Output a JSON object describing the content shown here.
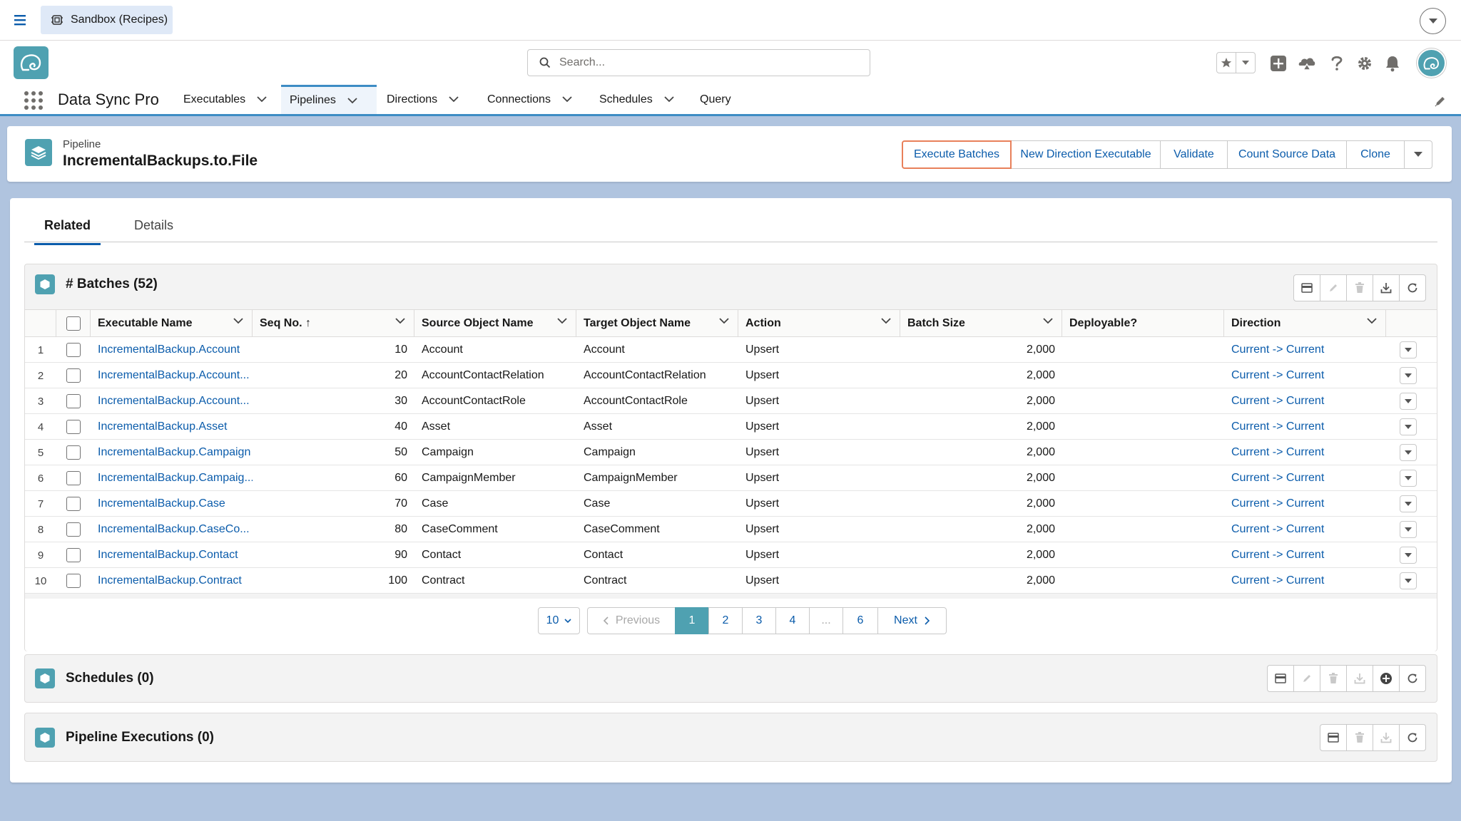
{
  "sandbox": {
    "label": "Sandbox (Recipes)"
  },
  "header": {
    "search_placeholder": "Search..."
  },
  "nav": {
    "app_name": "Data Sync Pro",
    "items": [
      {
        "label": "Executables"
      },
      {
        "label": "Pipelines"
      },
      {
        "label": "Directions"
      },
      {
        "label": "Connections"
      },
      {
        "label": "Schedules"
      },
      {
        "label": "Query"
      }
    ]
  },
  "record": {
    "type_label": "Pipeline",
    "title": "IncrementalBackups.to.File",
    "actions": [
      "Execute Batches",
      "New Direction Executable",
      "Validate",
      "Count Source Data",
      "Clone"
    ]
  },
  "tabs": [
    {
      "label": "Related"
    },
    {
      "label": "Details"
    }
  ],
  "batches": {
    "title": "# Batches (52)",
    "columns": [
      "Executable Name",
      "Seq No. ↑",
      "Source Object Name",
      "Target Object Name",
      "Action",
      "Batch Size",
      "Deployable?",
      "Direction"
    ],
    "rows": [
      {
        "num": "1",
        "name": "IncrementalBackup.Account",
        "seq": "10",
        "source": "Account",
        "target": "Account",
        "action": "Upsert",
        "size": "2,000",
        "deployable": "",
        "direction": "Current -> Current"
      },
      {
        "num": "2",
        "name": "IncrementalBackup.Account...",
        "seq": "20",
        "source": "AccountContactRelation",
        "target": "AccountContactRelation",
        "action": "Upsert",
        "size": "2,000",
        "deployable": "",
        "direction": "Current -> Current"
      },
      {
        "num": "3",
        "name": "IncrementalBackup.Account...",
        "seq": "30",
        "source": "AccountContactRole",
        "target": "AccountContactRole",
        "action": "Upsert",
        "size": "2,000",
        "deployable": "",
        "direction": "Current -> Current"
      },
      {
        "num": "4",
        "name": "IncrementalBackup.Asset",
        "seq": "40",
        "source": "Asset",
        "target": "Asset",
        "action": "Upsert",
        "size": "2,000",
        "deployable": "",
        "direction": "Current -> Current"
      },
      {
        "num": "5",
        "name": "IncrementalBackup.Campaign",
        "seq": "50",
        "source": "Campaign",
        "target": "Campaign",
        "action": "Upsert",
        "size": "2,000",
        "deployable": "",
        "direction": "Current -> Current"
      },
      {
        "num": "6",
        "name": "IncrementalBackup.Campaig...",
        "seq": "60",
        "source": "CampaignMember",
        "target": "CampaignMember",
        "action": "Upsert",
        "size": "2,000",
        "deployable": "",
        "direction": "Current -> Current"
      },
      {
        "num": "7",
        "name": "IncrementalBackup.Case",
        "seq": "70",
        "source": "Case",
        "target": "Case",
        "action": "Upsert",
        "size": "2,000",
        "deployable": "",
        "direction": "Current -> Current"
      },
      {
        "num": "8",
        "name": "IncrementalBackup.CaseCo...",
        "seq": "80",
        "source": "CaseComment",
        "target": "CaseComment",
        "action": "Upsert",
        "size": "2,000",
        "deployable": "",
        "direction": "Current -> Current"
      },
      {
        "num": "9",
        "name": "IncrementalBackup.Contact",
        "seq": "90",
        "source": "Contact",
        "target": "Contact",
        "action": "Upsert",
        "size": "2,000",
        "deployable": "",
        "direction": "Current -> Current"
      },
      {
        "num": "10",
        "name": "IncrementalBackup.Contract",
        "seq": "100",
        "source": "Contract",
        "target": "Contract",
        "action": "Upsert",
        "size": "2,000",
        "deployable": "",
        "direction": "Current -> Current"
      }
    ],
    "pagination": {
      "page_size": "10",
      "previous": "Previous",
      "pages": [
        "1",
        "2",
        "3",
        "4",
        "...",
        "6"
      ],
      "next": "Next",
      "current": "1"
    }
  },
  "schedules": {
    "title": "Schedules (0)"
  },
  "executions": {
    "title": "Pipeline Executions (0)"
  },
  "colors": {
    "brand": "#4fa1b1",
    "link": "#0b5cab",
    "nav_accent": "#3d8cc4",
    "highlight": "#e8805a",
    "background": "#b0c4df"
  }
}
